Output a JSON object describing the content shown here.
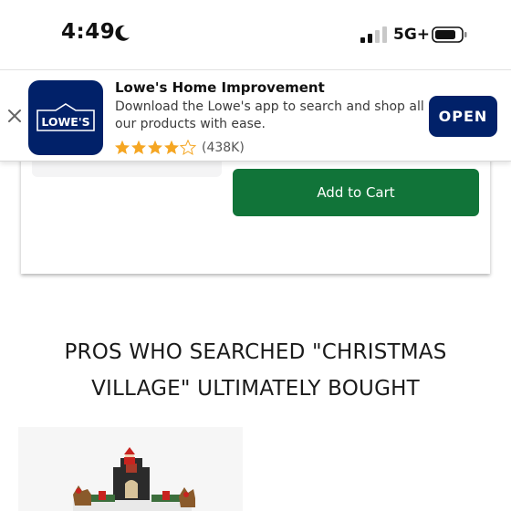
{
  "status_bar": {
    "time": "4:49",
    "network": "5G+",
    "icons": [
      "moon-icon",
      "signal-icon",
      "battery-icon"
    ]
  },
  "app_banner": {
    "app_name": "Lowe's Home Improvement",
    "description": "Download the Lowe's app to search and shop all our products with ease.",
    "rating_count": "(438K)",
    "rating_stars": 4.5,
    "open_label": "OPEN",
    "logo_text": "LOWE'S",
    "brand_color": "#012169",
    "star_color": "#f5a623"
  },
  "product_card": {
    "add_to_cart_label": "Add to Cart",
    "button_color": "#117439"
  },
  "section": {
    "title_line1": "PROS WHO SEARCHED \"CHRISTMAS",
    "title_line2": "VILLAGE\" ULTIMATELY BOUGHT"
  }
}
